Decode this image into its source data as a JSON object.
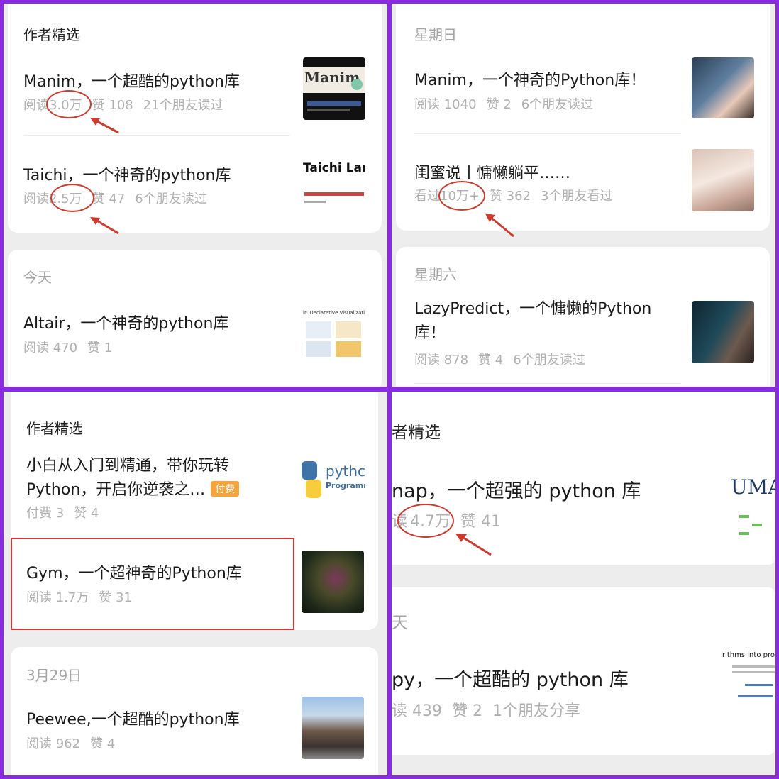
{
  "q1": {
    "section_featured": "作者精选",
    "item1": {
      "title": "Manim，一个超酷的python库",
      "read_label": "阅读",
      "read_value": "3.0万",
      "likes": "赞 108",
      "friends": "21个朋友读过",
      "thumb_text": "Manim"
    },
    "item2": {
      "title": "Taichi，一个神奇的python库",
      "read_label": "阅读",
      "read_value": "2.5万",
      "likes": "赞 47",
      "friends": "6个朋友读过",
      "thumb_text": "Taichi Lan"
    },
    "section_today": "今天",
    "item3": {
      "title": "Altair，一个神奇的python库",
      "read": "阅读 470",
      "likes": "赞 1",
      "thumb_text": "ir: Declarative Visualization in P"
    }
  },
  "q2": {
    "section_sunday": "星期日",
    "item1": {
      "title": "Manim，一个神奇的Python库！",
      "read": "阅读 1040",
      "likes": "赞 2",
      "friends": "6个朋友读过"
    },
    "item2": {
      "title": "闺蜜说丨慵懒躺平……",
      "read_label": "看过",
      "read_value": "10万+",
      "likes": "赞 362",
      "friends": "3个朋友看过"
    },
    "section_saturday": "星期六",
    "item3": {
      "title": "LazyPredict，一个慵懒的Python库！",
      "read": "阅读 878",
      "likes": "赞 4",
      "friends": "6个朋友读过"
    }
  },
  "q3": {
    "section_featured": "作者精选",
    "item1": {
      "title_line1": "小白从入门到精通，带你玩转",
      "title_line2": "Python，开启你逆袭之…",
      "badge": "付费",
      "paid": "付费 3",
      "likes": "赞 4",
      "thumb_line1": "pythc",
      "thumb_line2": "Programm"
    },
    "item2": {
      "title": "Gym，一个超神奇的Python库",
      "read": "阅读 1.7万",
      "likes": "赞 31"
    },
    "section_date": "3月29日",
    "item3": {
      "title": "Peewee,一个超酷的python库",
      "read": "阅读 962",
      "likes": "赞 4"
    }
  },
  "q4": {
    "section_featured": "者精选",
    "item1": {
      "title": "nap，一个超强的 python 库",
      "read_prefix": "读",
      "read_value": "4.7万",
      "likes": "赞 41",
      "thumb_text": "UMA"
    },
    "section_today": "天",
    "item2": {
      "title": "py，一个超酷的 python 库",
      "read": "读 439",
      "likes": "赞 2",
      "friends": "1个朋友分享",
      "thumb_text": "rithms into prod"
    }
  }
}
